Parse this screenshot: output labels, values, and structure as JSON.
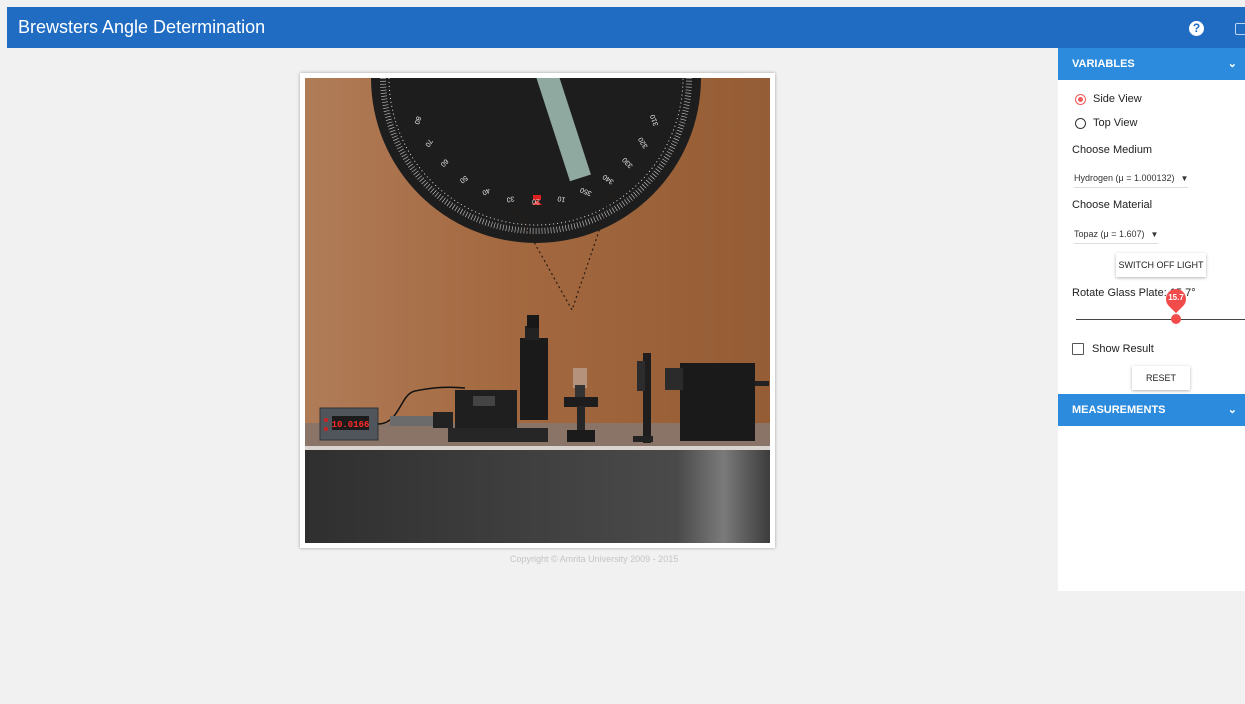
{
  "header": {
    "title": "Brewsters Angle Determination",
    "help_icon": "help-circle-icon",
    "fullscreen_icon": "fullscreen-icon",
    "bar_color": "#1f6cc2"
  },
  "simulation": {
    "dial_labels": [
      "80",
      "70",
      "60",
      "50",
      "40",
      "30",
      "20",
      "10",
      "350",
      "340",
      "330",
      "320",
      "310"
    ],
    "meter_reading": "10.0166",
    "copyright": "Copyright © Amrita University 2009 - 2015"
  },
  "panel": {
    "variables_header": "VARIABLES",
    "view_options": [
      {
        "label": "Side View",
        "selected": true
      },
      {
        "label": "Top View",
        "selected": false
      }
    ],
    "choose_medium_label": "Choose Medium",
    "medium_selected": "Hydrogen (μ = 1.000132)",
    "choose_material_label": "Choose Material",
    "material_selected": "Topaz (μ = 1.607)",
    "switch_light_label": "SWITCH OFF LIGHT",
    "rotate_label": "Rotate Glass Plate: 15.7°",
    "rotate_value": "15.7",
    "show_result_label": "Show Result",
    "reset_label": "RESET",
    "measurements_header": "MEASUREMENTS",
    "accent_color": "#2c8bdc"
  }
}
